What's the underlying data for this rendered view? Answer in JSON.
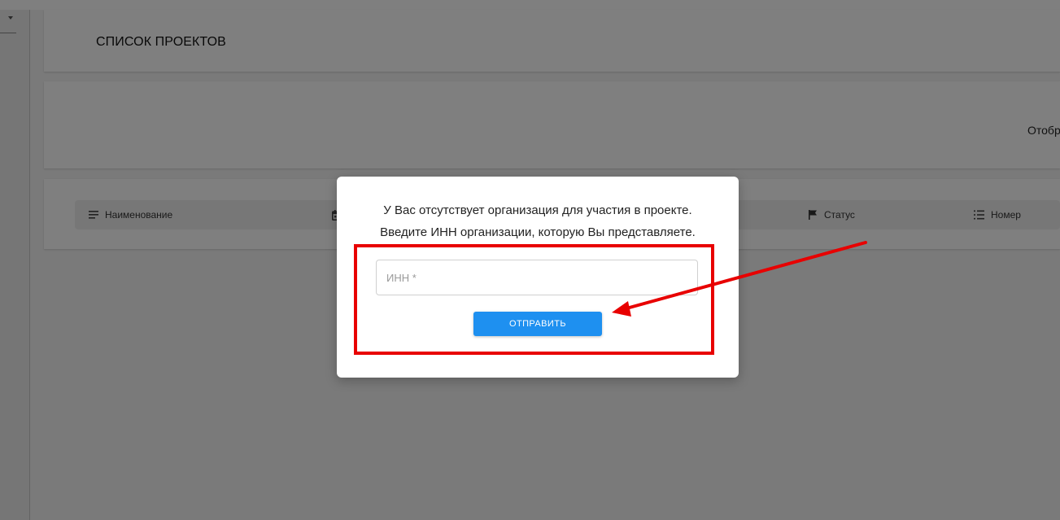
{
  "page": {
    "title": "СПИСОК ПРОЕКТОВ",
    "display_label": "Отображ"
  },
  "columns": [
    {
      "label": "Наименование",
      "icon": "subject-icon"
    },
    {
      "label": "",
      "icon": "calendar-icon"
    },
    {
      "label": "Статус",
      "icon": "flag-icon"
    },
    {
      "label": "Номер",
      "icon": "list-number-icon"
    }
  ],
  "dialog": {
    "message_line1": "У Вас отсутствует организация для участия в проекте.",
    "message_line2": "Введите ИНН организации, которую Вы представляете.",
    "inn_placeholder": "ИНН *",
    "inn_value": "",
    "submit_label": "ОТПРАВИТЬ"
  },
  "annotation": {
    "color": "#e80000"
  },
  "colors": {
    "accent": "#1e90f0",
    "overlay": "rgba(0,0,0,0.5)"
  }
}
